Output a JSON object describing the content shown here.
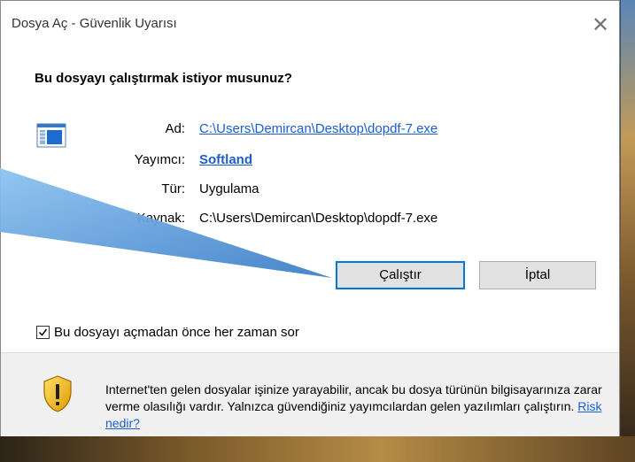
{
  "dialog": {
    "title": "Dosya Aç - Güvenlik Uyarısı",
    "question": "Bu dosyayı çalıştırmak istiyor musunuz?"
  },
  "details": {
    "name_label": "Ad:",
    "name_value": "C:\\Users\\Demircan\\Desktop\\dopdf-7.exe",
    "publisher_label": "Yayımcı:",
    "publisher_value": "Softland",
    "type_label": "Tür:",
    "type_value": "Uygulama",
    "source_label": "Kaynak:",
    "source_value": "C:\\Users\\Demircan\\Desktop\\dopdf-7.exe"
  },
  "buttons": {
    "run_label": "Çalıştır",
    "cancel_label": "İptal"
  },
  "checkbox": {
    "label": "Bu dosyayı açmadan önce her zaman sor",
    "checked": true
  },
  "warning": {
    "text": "Internet'ten gelen dosyalar işinize yarayabilir, ancak bu dosya türünün bilgisayarınıza zarar verme olasılığı vardır. Yalnızca güvendiğiniz yayımcılardan gelen yazılımları çalıştırın. ",
    "link_label": "Risk nedir?"
  },
  "icons": {
    "close": "close-icon",
    "app": "application-icon",
    "shield": "security-shield-icon",
    "check": "checkmark-icon"
  },
  "colors": {
    "link": "#1a5fcf",
    "primary_border": "#0078d7",
    "footer_bg": "#f0f0f0",
    "callout": "#4a90d9"
  }
}
